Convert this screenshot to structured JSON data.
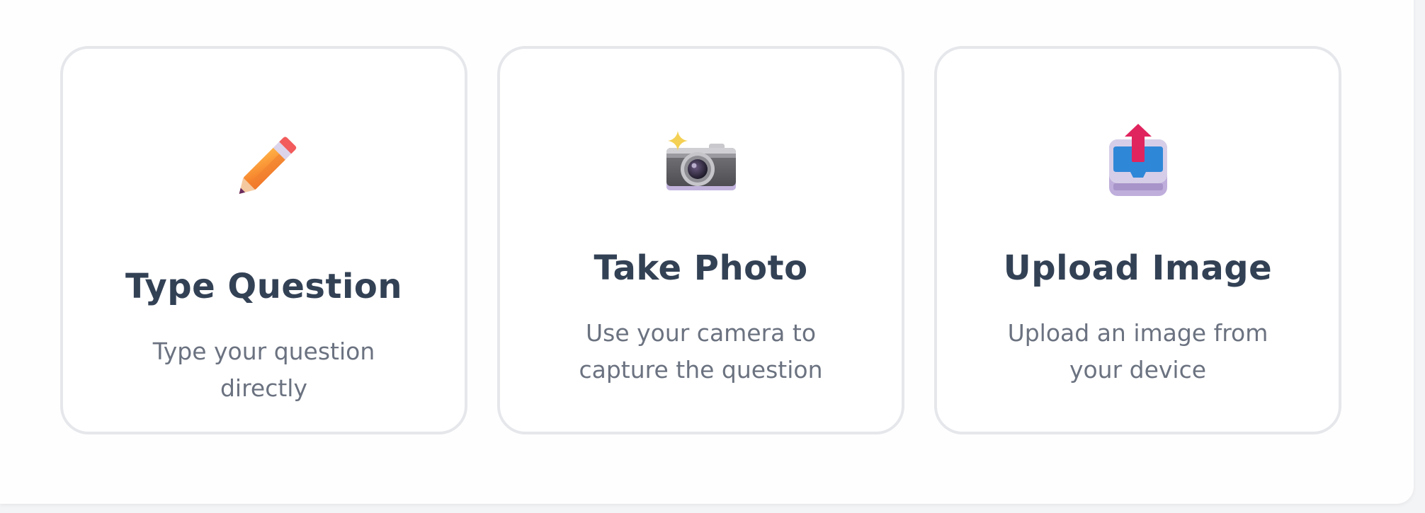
{
  "cards": [
    {
      "id": "type",
      "icon": "pencil-icon",
      "title": "Type Question",
      "description": "Type your question directly"
    },
    {
      "id": "photo",
      "icon": "camera-icon",
      "title": "Take Photo",
      "description": "Use your camera to capture the question"
    },
    {
      "id": "upload",
      "icon": "upload-tray-icon",
      "title": "Upload Image",
      "description": "Upload an image from your device"
    }
  ],
  "colors": {
    "card_border": "#e5e7eb",
    "title": "#334155",
    "description": "#6b7280",
    "page_background": "#f3f4f6"
  }
}
